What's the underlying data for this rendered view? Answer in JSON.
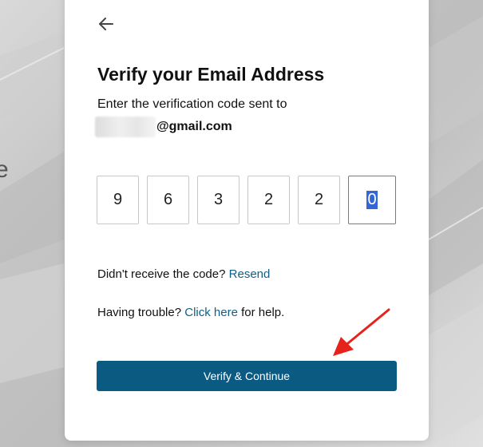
{
  "page": {
    "background_fragment": "e"
  },
  "card": {
    "back_icon": "arrow-left-icon",
    "title": "Verify your Email Address",
    "subtitle": "Enter the verification code sent to",
    "email_domain": "@gmail.com",
    "code_digits": [
      "9",
      "6",
      "3",
      "2",
      "2",
      "0"
    ],
    "resend_prompt": "Didn't receive the code?",
    "resend_link": "Resend",
    "trouble_prompt": "Having trouble?",
    "trouble_link": "Click here",
    "trouble_suffix": "for help.",
    "verify_button": "Verify & Continue"
  },
  "colors": {
    "button": "#0b5a82",
    "link": "#0f5f86",
    "annotation_arrow": "#e5231b"
  }
}
